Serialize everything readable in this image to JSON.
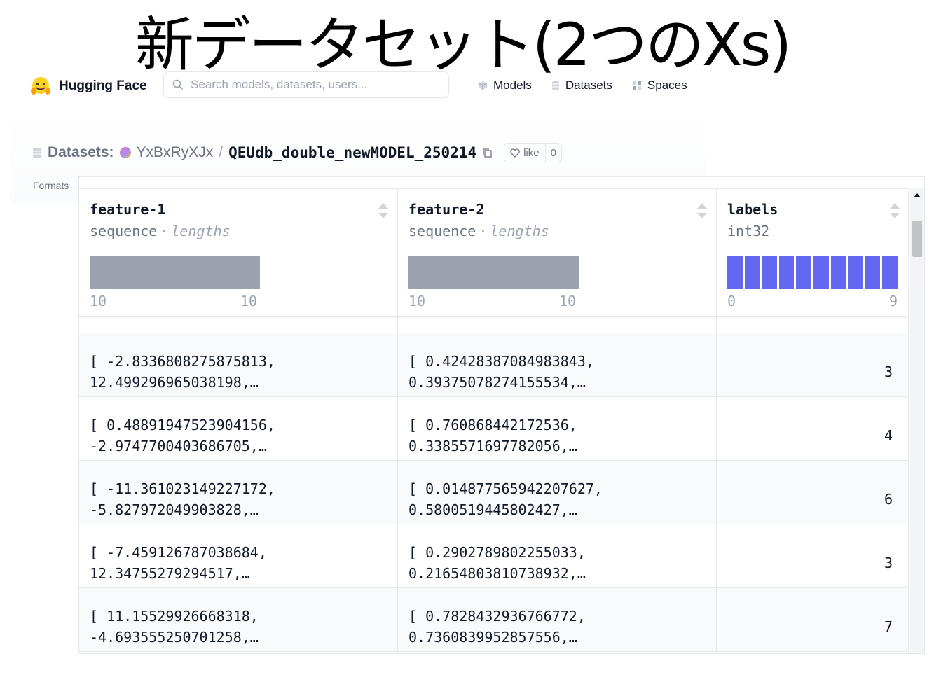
{
  "slide_title": "新データセット(2つのXs)",
  "header": {
    "logo_text": "Hugging Face",
    "search_placeholder": "Search models, datasets, users...",
    "nav": [
      {
        "label": "Models",
        "icon": "cube-icon"
      },
      {
        "label": "Datasets",
        "icon": "database-icon"
      },
      {
        "label": "Spaces",
        "icon": "grid-icon"
      }
    ]
  },
  "dataset": {
    "prefix": "Datasets:",
    "owner": "YxBxRyXJx",
    "separator": "/",
    "name": "QEUdb_double_newMODEL_250214",
    "like_label": "like",
    "like_count": "0",
    "formats_label": "Formats"
  },
  "columns": [
    {
      "name": "feature-1",
      "type": "sequence",
      "stat": "lengths",
      "min": "10",
      "max": "10"
    },
    {
      "name": "feature-2",
      "type": "sequence",
      "stat": "lengths",
      "min": "10",
      "max": "10"
    },
    {
      "name": "labels",
      "type": "int32",
      "min": "0",
      "max": "9"
    }
  ],
  "labels_histogram": [
    1,
    1,
    1,
    1,
    1,
    1,
    1,
    1,
    1,
    1
  ],
  "rows": [
    {
      "f1": [
        "[ -2.8336808275875813,",
        "12.499296965038198,…"
      ],
      "f2": [
        "[ 0.42428387084983843,",
        "0.39375078274155534,…"
      ],
      "label": "3"
    },
    {
      "f1": [
        "[ 0.48891947523904156,",
        "-2.9747700403686705,…"
      ],
      "f2": [
        "[ 0.760868442172536,",
        "0.3385571697782056,…"
      ],
      "label": "4"
    },
    {
      "f1": [
        "[ -11.361023149227172,",
        "-5.827972049903828,…"
      ],
      "f2": [
        "[ 0.014877565942207627,",
        "0.5800519445802427,…"
      ],
      "label": "6"
    },
    {
      "f1": [
        "[ -7.459126787038684,",
        "12.34755279294517,…"
      ],
      "f2": [
        "[ 0.2902789802255033,",
        "0.21654803810738932,…"
      ],
      "label": "3"
    },
    {
      "f1": [
        "[ 11.15529926668318,",
        "-4.693555250701258,…"
      ],
      "f2": [
        "[ 0.7828432936766772,",
        "0.7360839952857556,…"
      ],
      "label": "7"
    }
  ]
}
